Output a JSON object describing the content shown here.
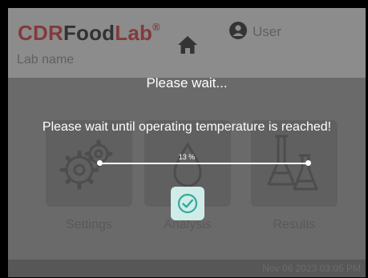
{
  "header": {
    "brand": {
      "cdr": "CDR",
      "food": "Food",
      "lab": "Lab",
      "reg": "®"
    },
    "lab_name": "Lab name",
    "user_label": "User"
  },
  "tiles": [
    {
      "label": "Settings",
      "icon": "gears-icon"
    },
    {
      "label": "Analysis",
      "icon": "drop-icon"
    },
    {
      "label": "Results",
      "icon": "flasks-icon"
    }
  ],
  "footer": {
    "datetime": "Nov 06 2023 03:05 PM"
  },
  "dialog": {
    "title": "Please wait...",
    "message": "Please wait until operating temperature is reached!",
    "progress": {
      "label": "13 %",
      "value": 13
    }
  },
  "colors": {
    "accent_red": "#b53a3c",
    "confirm_green": "#34a99a"
  }
}
